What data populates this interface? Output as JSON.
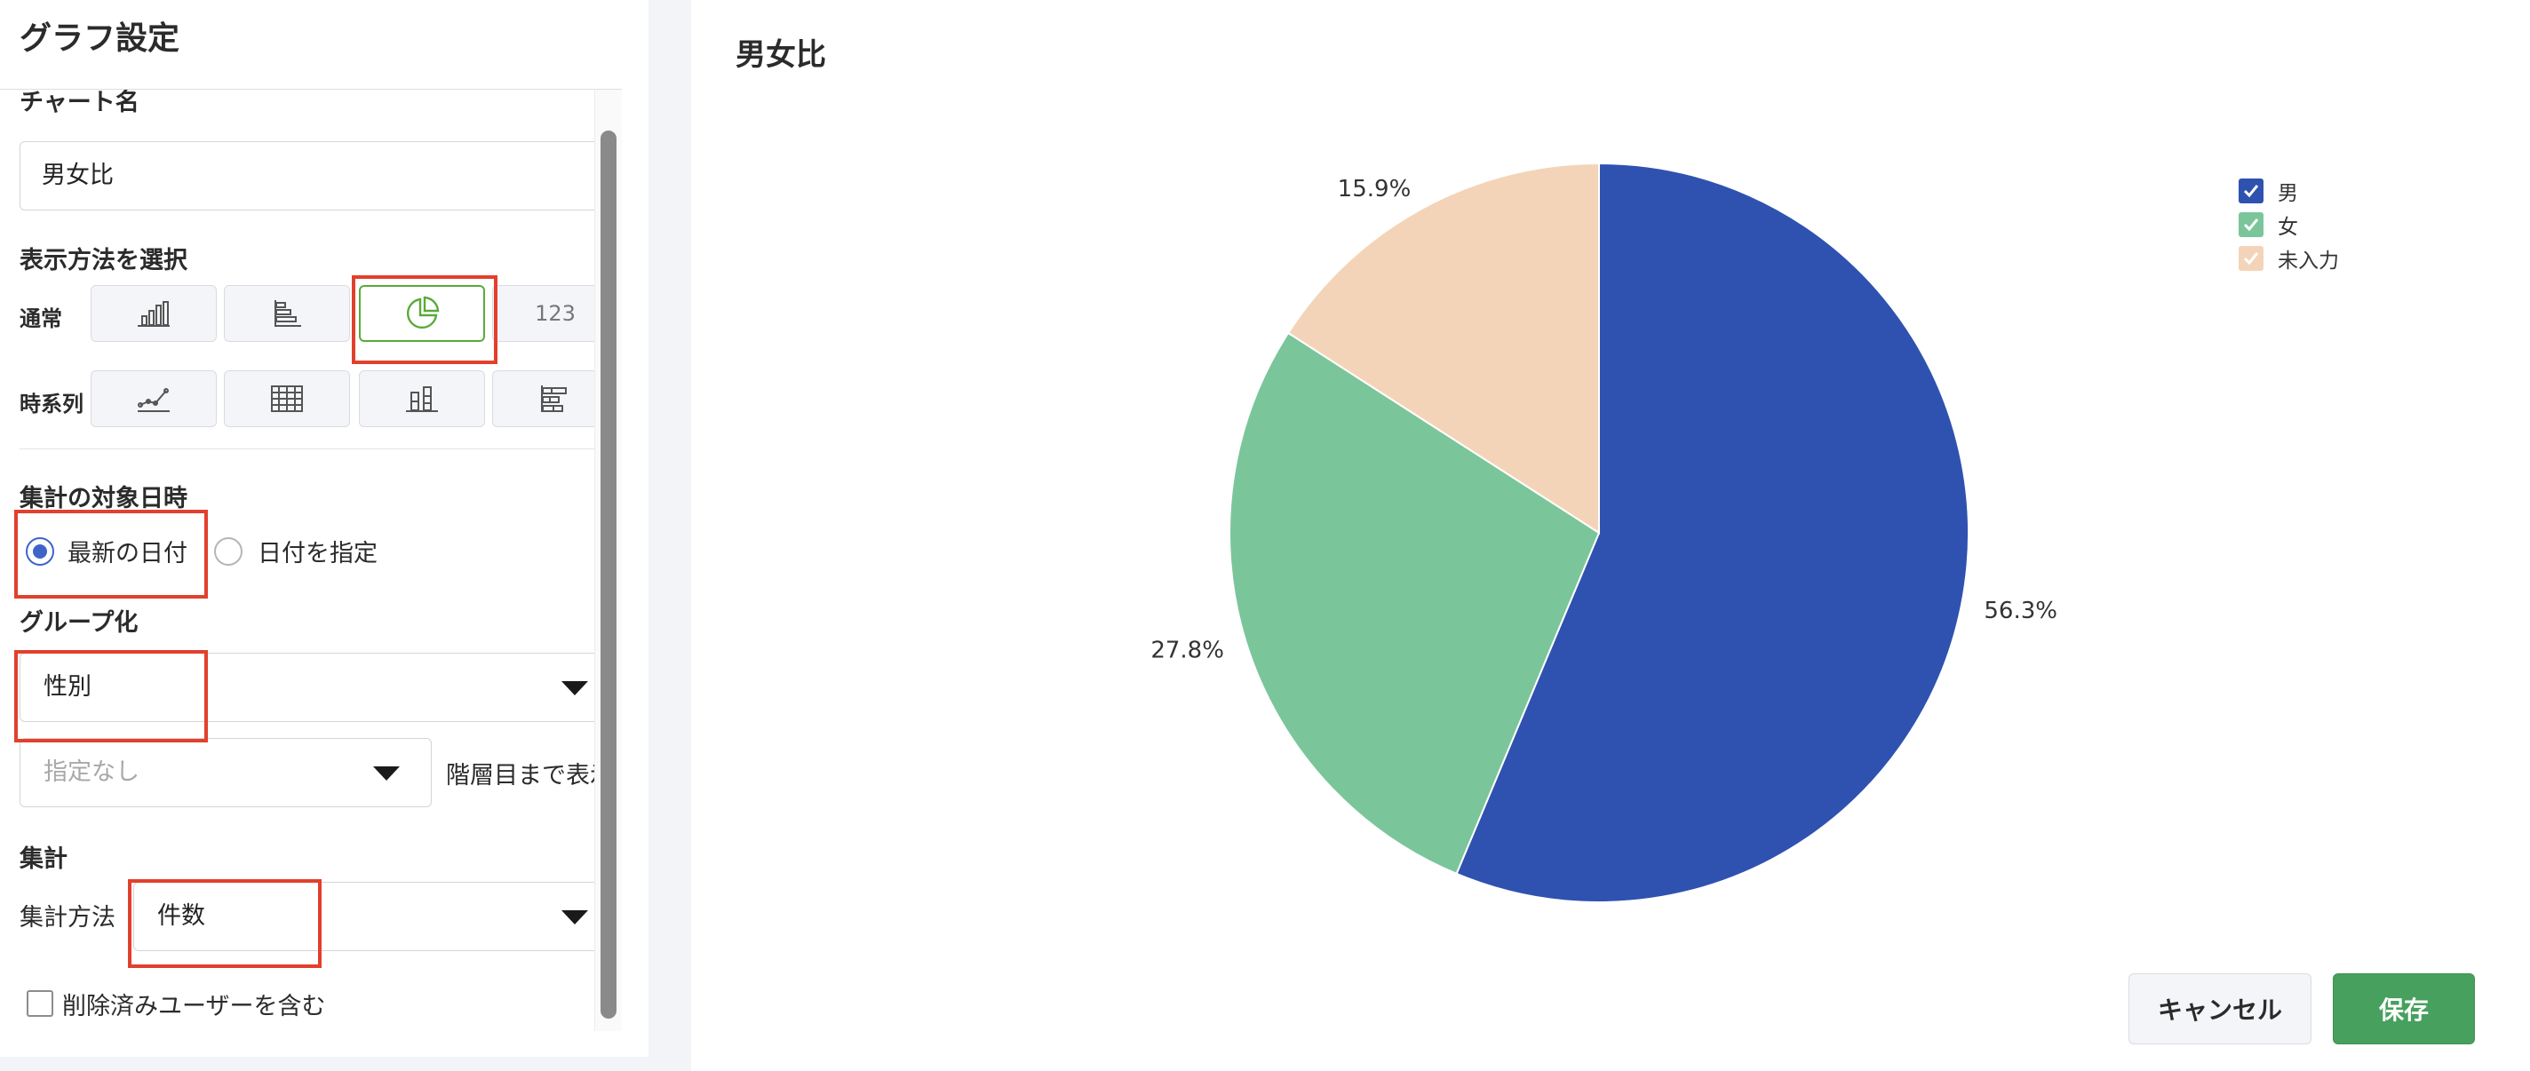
{
  "settings": {
    "title": "グラフ設定",
    "chart_name": {
      "label": "チャート名",
      "value": "男女比"
    },
    "display_method": {
      "label": "表示方法を選択",
      "normal_label": "通常",
      "timeseries_label": "時系列",
      "normal_options": [
        {
          "icon": "vertical-bar-chart-icon",
          "selected": false
        },
        {
          "icon": "horizontal-bar-chart-icon",
          "selected": false
        },
        {
          "icon": "pie-chart-icon",
          "selected": true
        },
        {
          "icon": "number",
          "text": "123",
          "selected": false
        }
      ],
      "timeseries_options": [
        {
          "icon": "line-chart-icon"
        },
        {
          "icon": "table-grid-icon"
        },
        {
          "icon": "stacked-bar-chart-icon"
        },
        {
          "icon": "stacked-horizontal-bar-icon"
        }
      ]
    },
    "target_date": {
      "label": "集計の対象日時",
      "options": [
        "最新の日付",
        "日付を指定"
      ],
      "selected": "最新の日付"
    },
    "grouping": {
      "label": "グループ化",
      "primary": "性別",
      "secondary_placeholder": "指定なし",
      "level_text": "階層目まで表示"
    },
    "aggregation": {
      "label": "集計",
      "method_label": "集計方法",
      "method_value": "件数"
    },
    "include_deleted_label": "削除済みユーザーを含む",
    "include_deleted": false
  },
  "chart": {
    "title": "男女比",
    "cancel_label": "キャンセル",
    "save_label": "保存",
    "colors": {
      "accent_green": "#47a05e",
      "highlight_red": "#e2402c"
    }
  },
  "chart_data": {
    "type": "pie",
    "title": "男女比",
    "categories": [
      "男",
      "女",
      "未入力"
    ],
    "values": [
      56.3,
      27.8,
      15.9
    ],
    "labels": [
      "56.3%",
      "27.8%",
      "15.9%"
    ],
    "colors": [
      "#2f52b0",
      "#7bc59a",
      "#f4d4b8"
    ],
    "legend": "top-right",
    "legend_checked": [
      true,
      true,
      true
    ]
  }
}
